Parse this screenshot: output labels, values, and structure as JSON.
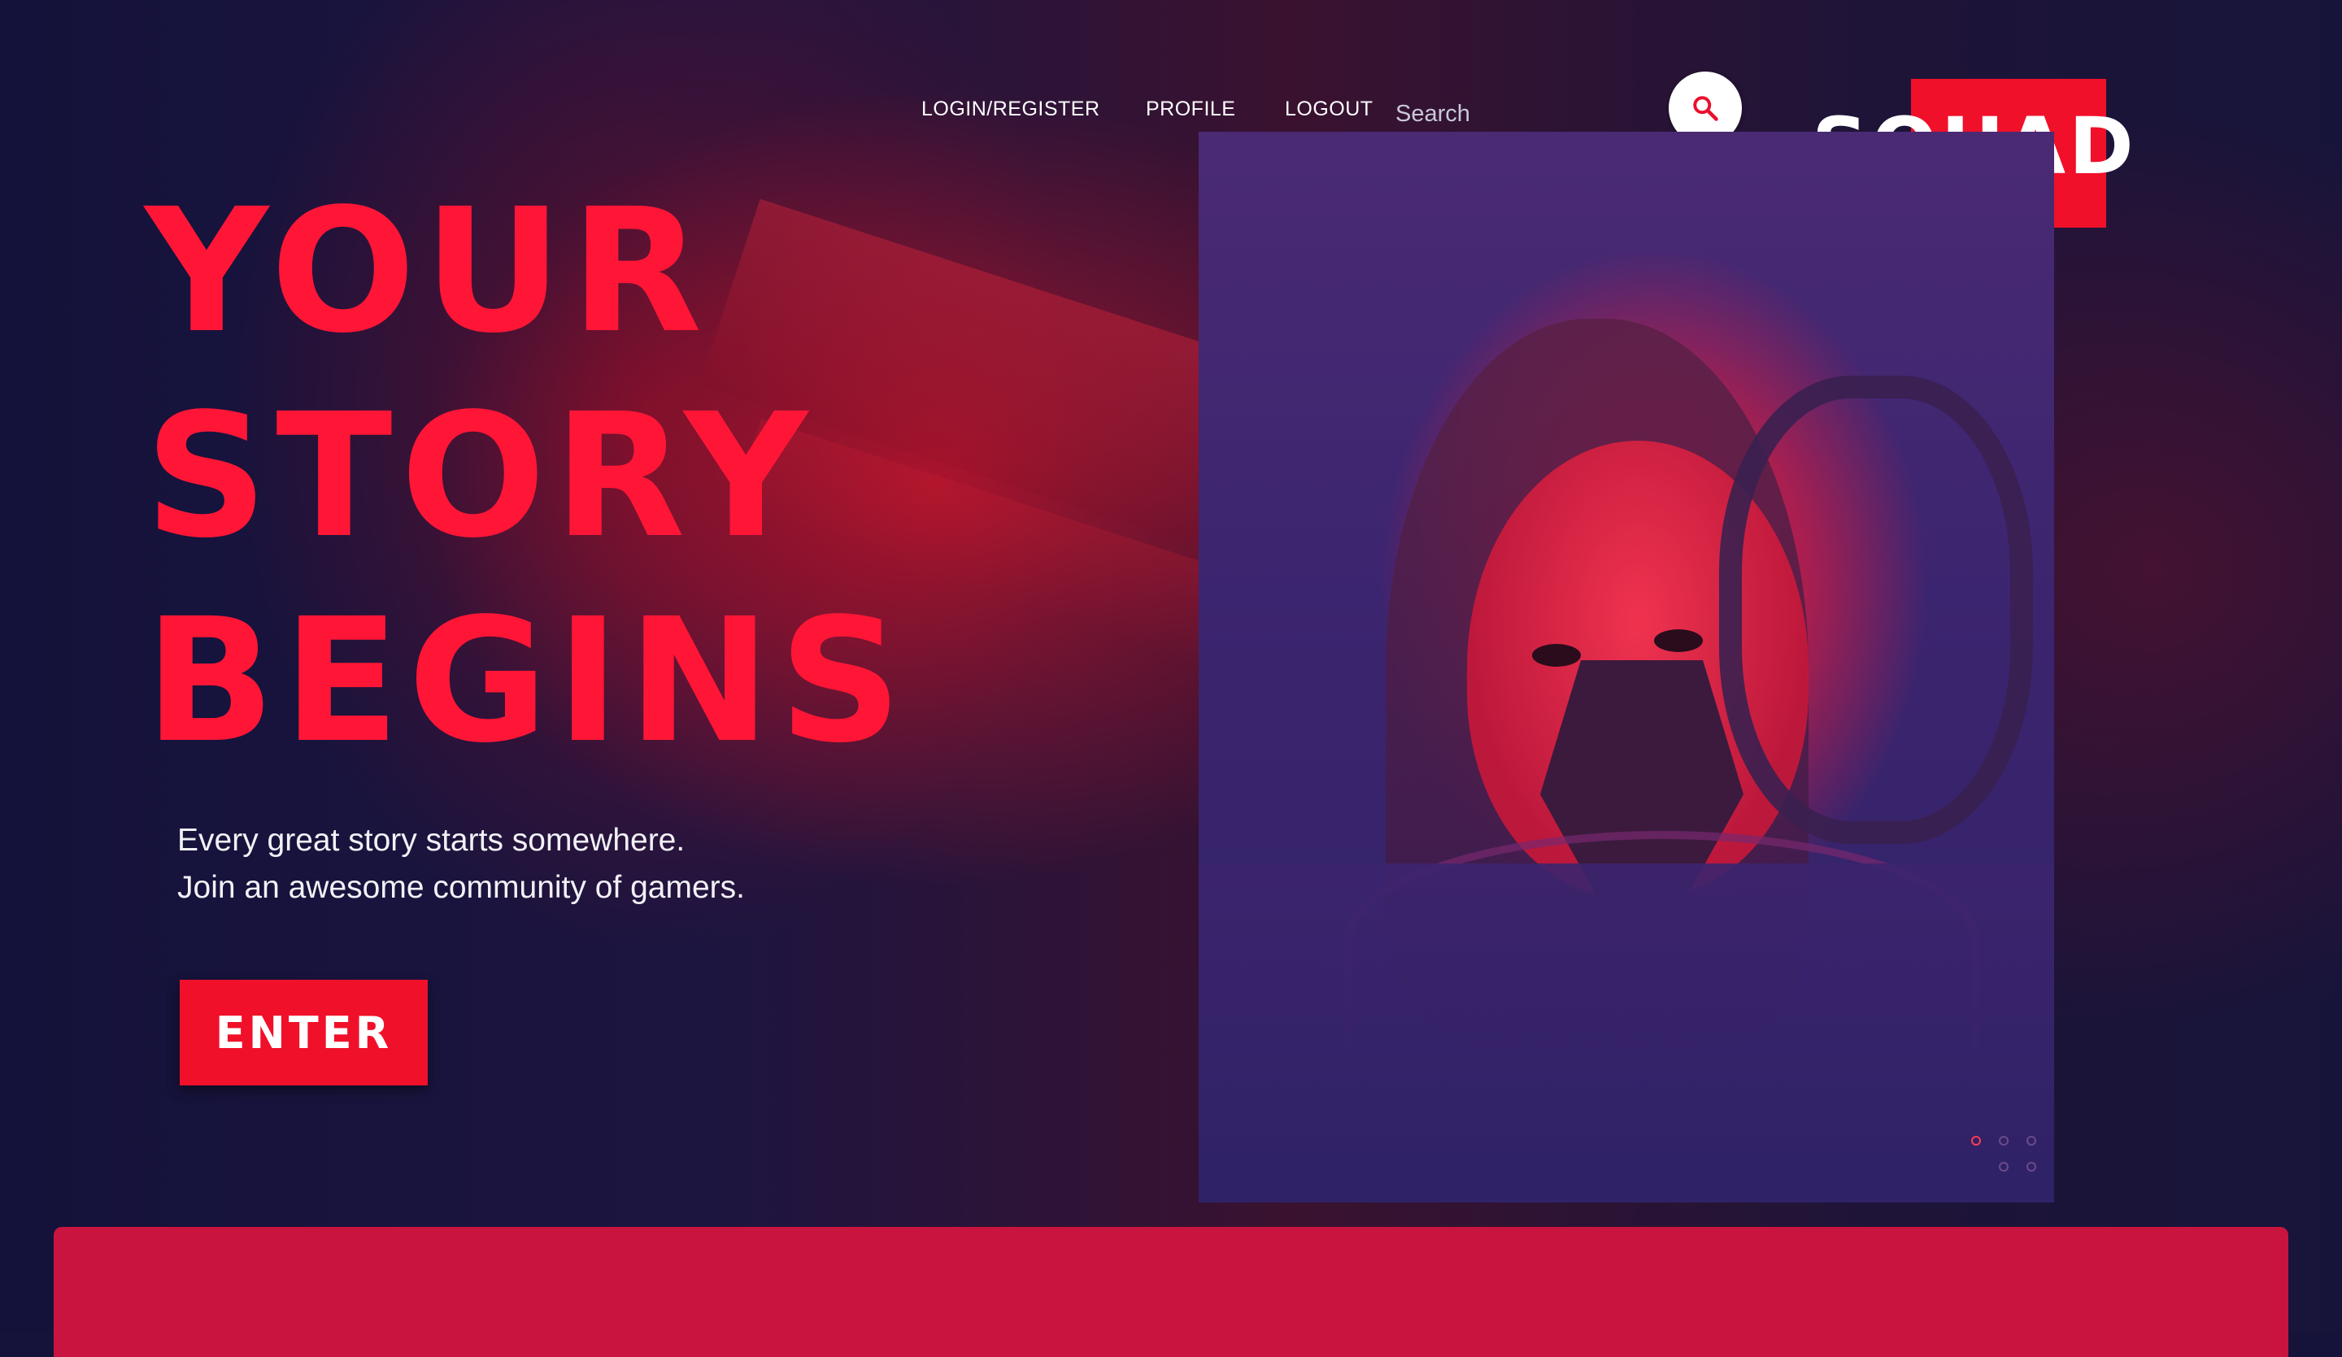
{
  "nav": {
    "items": [
      {
        "label": "LOGIN/REGISTER"
      },
      {
        "label": "PROFILE"
      },
      {
        "label": "LOGOUT"
      }
    ],
    "search": {
      "placeholder": "Search",
      "value": ""
    }
  },
  "brand": {
    "logo_text": "SQUAD",
    "accent": "#f0102a"
  },
  "hero": {
    "title_lines": [
      "YOUR",
      "STORY",
      "BEGINS"
    ],
    "tagline_lines": [
      "Every great story starts somewhere.",
      "Join an awesome community of gamers."
    ],
    "cta_label": "ENTER"
  },
  "colors": {
    "background": "#15133a",
    "accent": "#f0102a",
    "panel": "#c8143e"
  },
  "icons": {
    "search": "search-icon"
  }
}
